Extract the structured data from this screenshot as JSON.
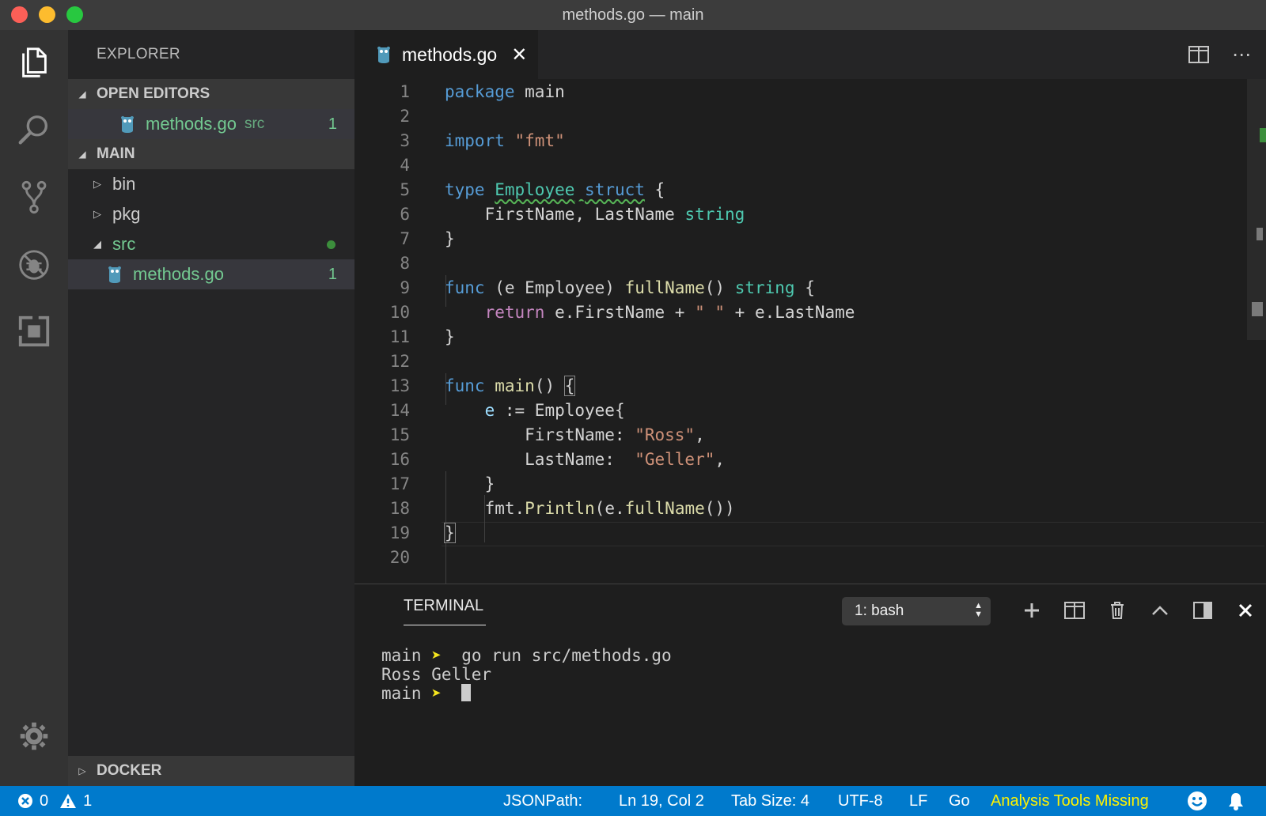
{
  "window": {
    "title": "methods.go — main"
  },
  "sidebar": {
    "header": "EXPLORER",
    "open_editors": {
      "title": "OPEN EDITORS",
      "items": [
        {
          "name": "methods.go",
          "description": "src",
          "problems": "1"
        }
      ]
    },
    "workspace": {
      "title": "MAIN",
      "items": [
        {
          "name": "bin"
        },
        {
          "name": "pkg"
        },
        {
          "name": "src"
        },
        {
          "name": "methods.go",
          "problems": "1"
        }
      ]
    },
    "docker": {
      "title": "DOCKER"
    }
  },
  "editor": {
    "tab": {
      "label": "methods.go",
      "close": "✕"
    },
    "line_numbers": [
      "1",
      "2",
      "3",
      "4",
      "5",
      "6",
      "7",
      "8",
      "9",
      "10",
      "11",
      "12",
      "13",
      "14",
      "15",
      "16",
      "17",
      "18",
      "19",
      "20"
    ]
  },
  "panel": {
    "tab": "TERMINAL",
    "terminal_select": "1: bash",
    "lines": {
      "l1_dir": "main",
      "l1_arrow": "➤",
      "l1_cmd": "go run src/methods.go",
      "l2": "Ross Geller",
      "l3_dir": "main",
      "l3_arrow": "➤"
    }
  },
  "statusbar": {
    "errors": "0",
    "warnings": "1",
    "jsonpath": "JSONPath:",
    "position": "Ln 19, Col 2",
    "tab_size": "Tab Size: 4",
    "encoding": "UTF-8",
    "eol": "LF",
    "language": "Go",
    "analysis": "Analysis Tools Missing"
  },
  "colors": {
    "accent": "#007acc",
    "keyword": "#569cd6",
    "string": "#ce9178",
    "type": "#4ec9b0",
    "function": "#dcdcaa",
    "git_added": "#73c991"
  },
  "icons": {
    "activity": [
      "files-icon",
      "search-icon",
      "source-control-icon",
      "debug-icon",
      "extensions-icon",
      "gear-icon"
    ],
    "file": "go-gopher-icon"
  }
}
